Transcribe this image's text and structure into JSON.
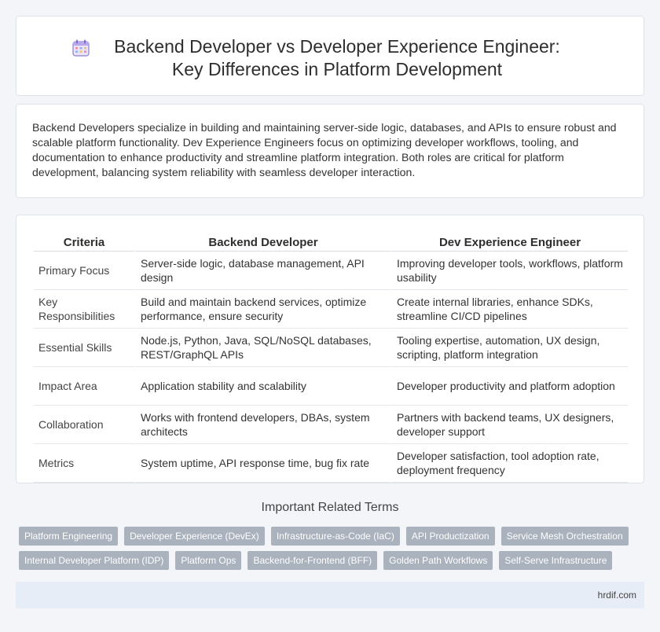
{
  "header": {
    "title": "Backend Developer vs Developer Experience Engineer: Key Differences in Platform Development",
    "icon": "calendar-icon"
  },
  "intro": {
    "text": "Backend Developers specialize in building and maintaining server-side logic, databases, and APIs to ensure robust and scalable platform functionality. Dev Experience Engineers focus on optimizing developer workflows, tooling, and documentation to enhance productivity and streamline platform integration. Both roles are critical for platform development, balancing system reliability with seamless developer interaction."
  },
  "table": {
    "headers": [
      "Criteria",
      "Backend Developer",
      "Dev Experience Engineer"
    ],
    "rows": [
      [
        "Primary Focus",
        "Server-side logic, database management, API design",
        "Improving developer tools, workflows, platform usability"
      ],
      [
        "Key Responsibilities",
        "Build and maintain backend services, optimize performance, ensure security",
        "Create internal libraries, enhance SDKs, streamline CI/CD pipelines"
      ],
      [
        "Essential Skills",
        "Node.js, Python, Java, SQL/NoSQL databases, REST/GraphQL APIs",
        "Tooling expertise, automation, UX design, scripting, platform integration"
      ],
      [
        "Impact Area",
        "Application stability and scalability",
        "Developer productivity and platform adoption"
      ],
      [
        "Collaboration",
        "Works with frontend developers, DBAs, system architects",
        "Partners with backend teams, UX designers, developer support"
      ],
      [
        "Metrics",
        "System uptime, API response time, bug fix rate",
        "Developer satisfaction, tool adoption rate, deployment frequency"
      ]
    ]
  },
  "related": {
    "heading": "Important Related Terms",
    "row1": [
      "Platform Engineering",
      "Developer Experience (DevEx)",
      "Infrastructure-as-Code (IaC)",
      "API Productization",
      "Service Mesh Orchestration"
    ],
    "row2": [
      "Internal Developer Platform (IDP)",
      "Platform Ops",
      "Backend-for-Frontend (BFF)",
      "Golden Path Workflows",
      "Self-Serve Infrastructure"
    ]
  },
  "footer": {
    "site": "hrdif.com"
  },
  "colors": {
    "tag_bg": "#a9b2bd",
    "footer_bg": "#e6edf6",
    "page_bg": "#f3f5f8"
  }
}
